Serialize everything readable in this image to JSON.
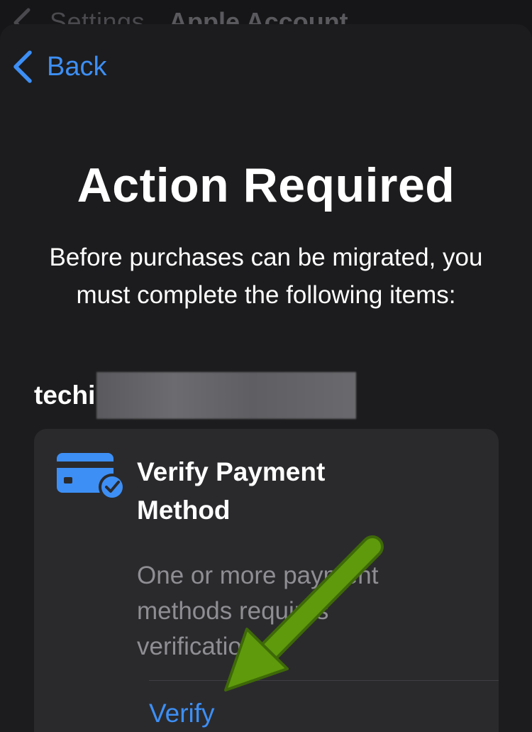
{
  "behind_nav": {
    "back_label": "Settings",
    "title": "Apple Account"
  },
  "sheet": {
    "back_label": "Back",
    "title": "Action Required",
    "description": "Before purchases can be migrated, you must complete the following items:",
    "account_prefix": "techi"
  },
  "card": {
    "icon": "credit-card-check-icon",
    "title": "Verify Payment Method",
    "body": "One or more payment methods requires verification.",
    "action_label": "Verify"
  },
  "colors": {
    "accent_blue": "#3d8ff5",
    "annotation_green": "#5e9a0c",
    "sheet_bg": "#1c1c1e",
    "card_bg": "#2a2a2d",
    "secondary_text": "#8e8e93"
  }
}
